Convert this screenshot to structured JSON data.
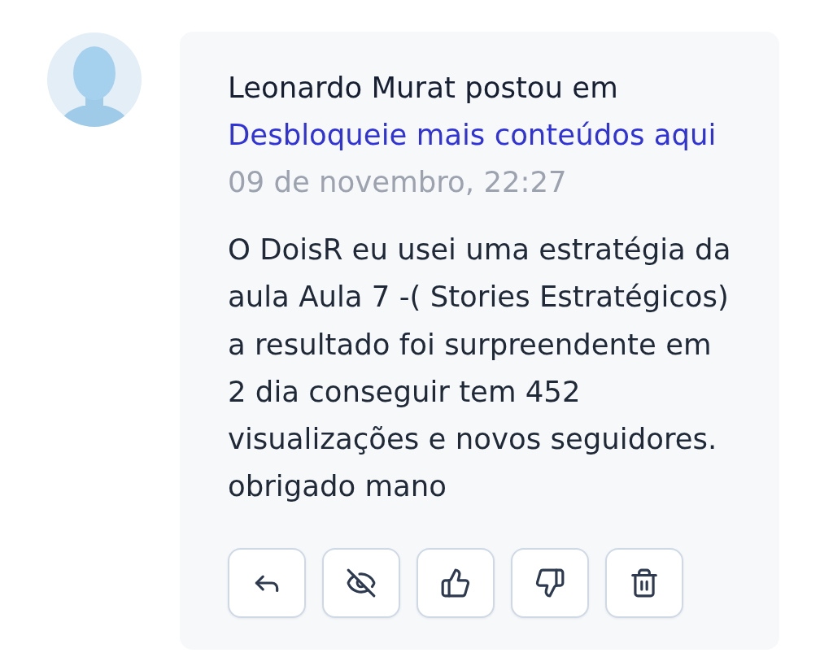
{
  "post": {
    "author_line": "Leonardo Murat postou em",
    "link": "Desbloqueie mais conteúdos aqui",
    "date": "09 de novembro, 22:27",
    "body_lines": [
      "O DoisR eu usei uma estratégia da",
      "aula Aula 7 -( Stories Estratégicos)",
      "a resultado foi surpreendente em",
      "2 dia conseguir tem 452",
      "visualizações e novos seguidores.",
      "obrigado mano"
    ]
  }
}
